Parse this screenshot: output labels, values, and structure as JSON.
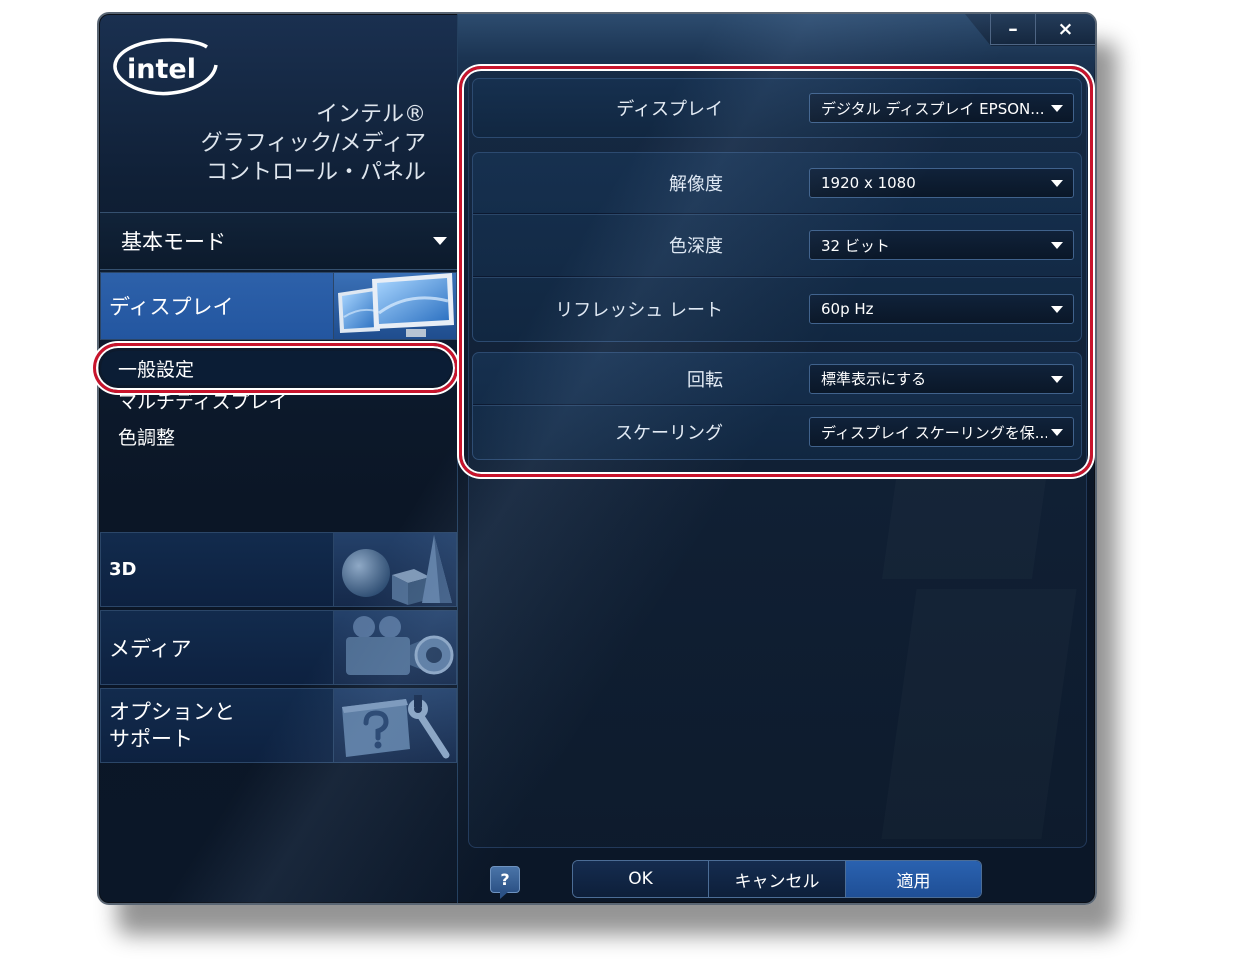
{
  "window": {
    "minimize_label": "–",
    "close_label": "×"
  },
  "brand": {
    "logo_text": "intel",
    "title_lines": [
      "インテル®",
      "グラフィック/メディア",
      "コントロール・パネル"
    ]
  },
  "sidebar": {
    "mode_selector": {
      "label": "基本モード",
      "icon": "chevron-down-icon"
    },
    "display": {
      "label": "ディスプレイ",
      "selected": true,
      "icon": "monitors-icon",
      "subitems": [
        {
          "label": "一般設定",
          "selected": true
        },
        {
          "label": "マルチディスプレイ",
          "selected": false
        },
        {
          "label": "色調整",
          "selected": false
        }
      ]
    },
    "sections": [
      {
        "label": "3D",
        "icon": "3d-shapes-icon"
      },
      {
        "label": "メディア",
        "icon": "video-camera-icon"
      },
      {
        "label_lines": [
          "オプションと",
          "サポート"
        ],
        "icon": "help-wrench-icon"
      }
    ]
  },
  "settings": {
    "groups": [
      {
        "rows": [
          {
            "label": "ディスプレイ",
            "value": "デジタル ディスプレイ EPSON..."
          }
        ]
      },
      {
        "rows": [
          {
            "label": "解像度",
            "value": "1920 x 1080"
          },
          {
            "label": "色深度",
            "value": "32 ビット"
          },
          {
            "label": "リフレッシュ レート",
            "value": "60p Hz"
          }
        ]
      },
      {
        "rows": [
          {
            "label": "回転",
            "value": "標準表示にする"
          },
          {
            "label": "スケーリング",
            "value": "ディスプレイ スケーリングを保..."
          }
        ]
      }
    ]
  },
  "footer": {
    "help_label": "?",
    "buttons": [
      {
        "label": "OK"
      },
      {
        "label": "キャンセル"
      },
      {
        "label": "適用",
        "primary": true
      }
    ]
  },
  "colors": {
    "window_bg": "#0b1626",
    "selected_blue": "#2356a0",
    "apply_blue": "#1f4f96",
    "annotation_red": "#c8142c"
  }
}
